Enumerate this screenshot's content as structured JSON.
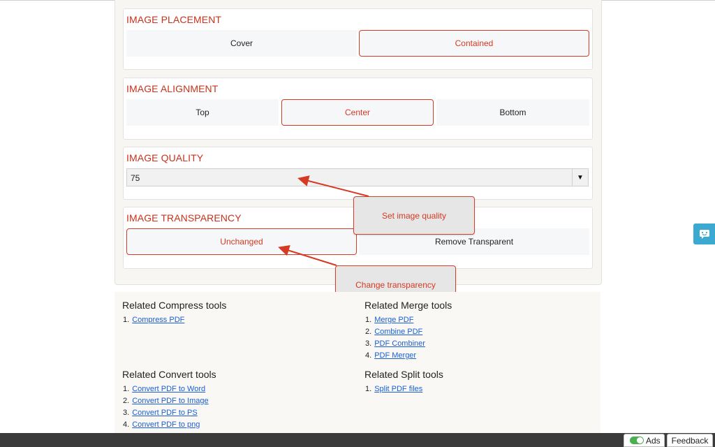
{
  "placement": {
    "title": "IMAGE PLACEMENT",
    "options": [
      "Cover",
      "Contained"
    ],
    "selected": "Contained"
  },
  "alignment": {
    "title": "IMAGE ALIGNMENT",
    "options": [
      "Top",
      "Center",
      "Bottom"
    ],
    "selected": "Center"
  },
  "quality": {
    "title": "IMAGE QUALITY",
    "value": "75"
  },
  "transparency": {
    "title": "IMAGE TRANSPARENCY",
    "options": [
      "Unchanged",
      "Remove Transparent"
    ],
    "selected": "Unchanged"
  },
  "callouts": {
    "quality": "Set image quality",
    "transparency": "Change transparency"
  },
  "related": {
    "compress": {
      "title": "Related Compress tools",
      "items": [
        "Compress PDF"
      ]
    },
    "merge": {
      "title": "Related Merge tools",
      "items": [
        "Merge PDF",
        "Combine PDF",
        "PDF Combiner",
        "PDF Merger"
      ]
    },
    "convert": {
      "title": "Related Convert tools",
      "items": [
        "Convert PDF to Word",
        "Convert PDF to Image",
        "Convert PDF to PS",
        "Convert PDF to png"
      ]
    },
    "split": {
      "title": "Related Split tools",
      "items": [
        "Split PDF files"
      ]
    }
  },
  "footer": {
    "ads_label": "Ads",
    "feedback_label": "Feedback"
  },
  "icons": {
    "select_arrow": "▼",
    "side_widget": "chat-icon"
  },
  "colors": {
    "accent": "#d53a23",
    "link": "#1a5fd6",
    "side_widget": "#3ca9d0",
    "toggle_on": "#4caf50"
  }
}
